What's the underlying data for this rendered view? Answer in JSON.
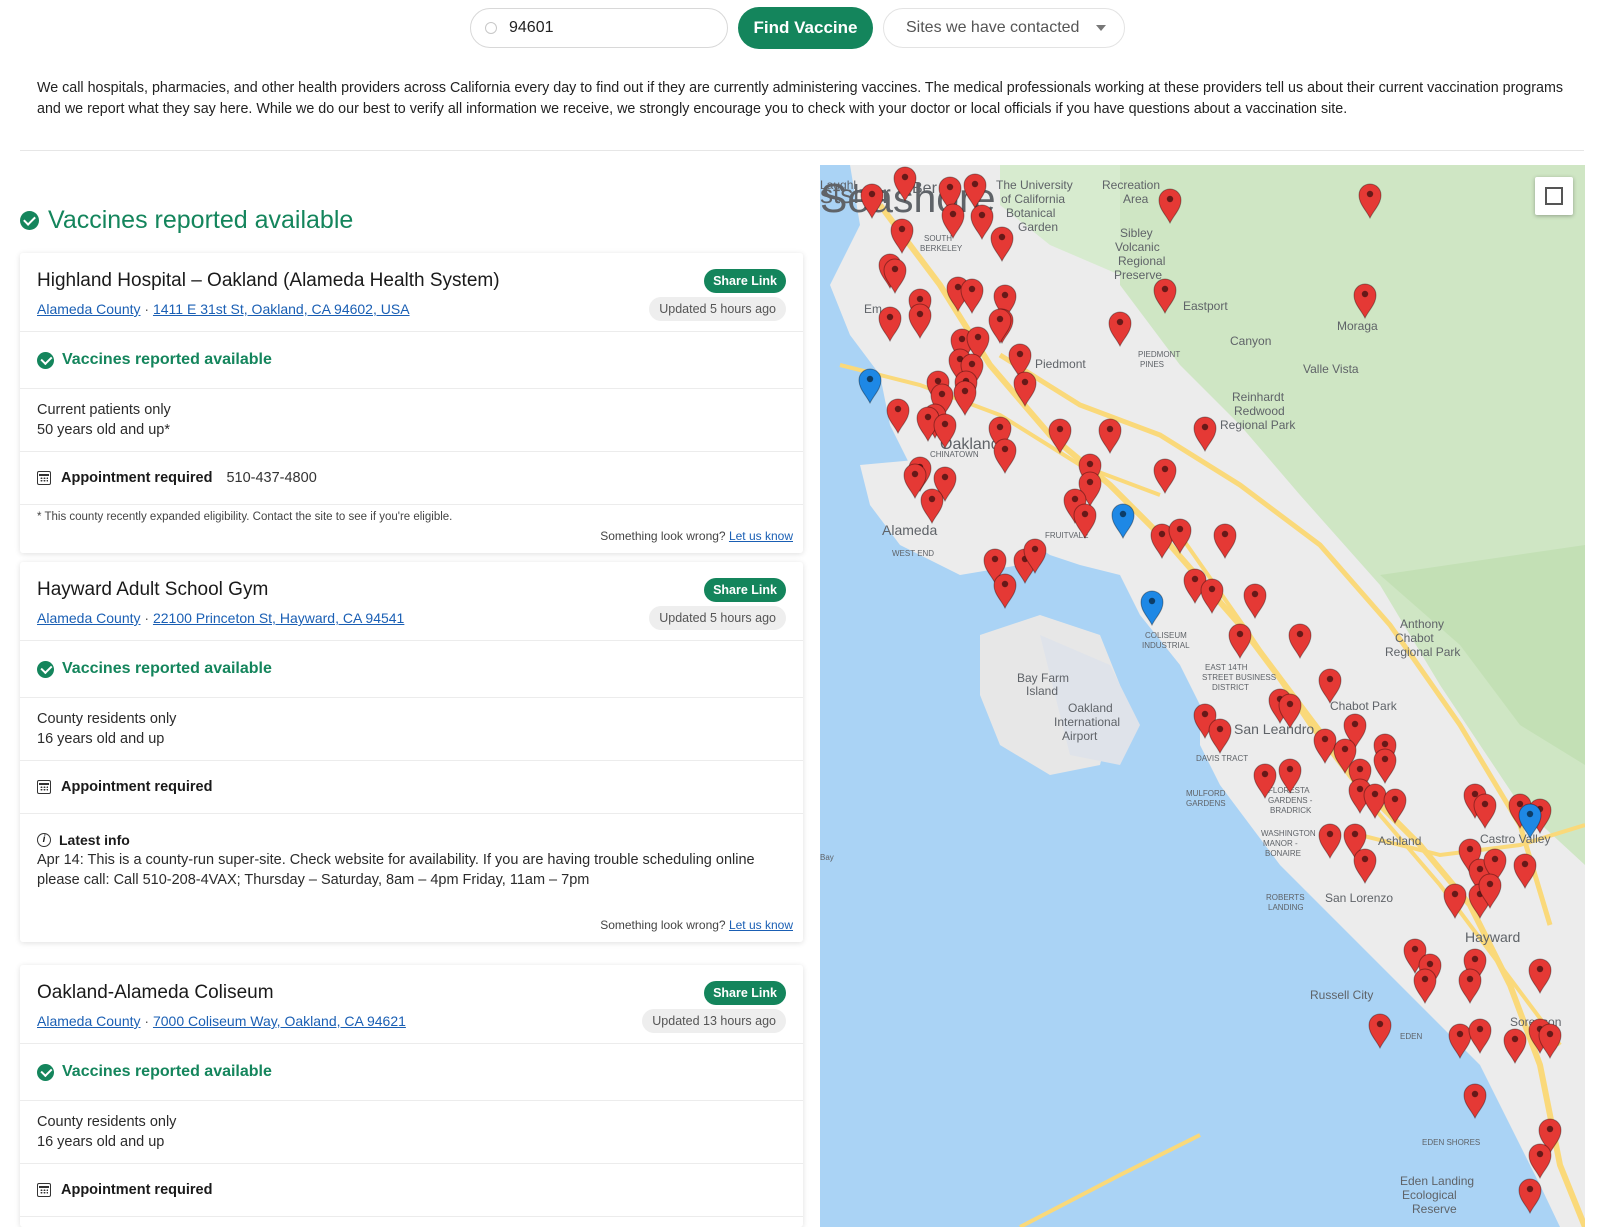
{
  "search": {
    "zip_value": "94601",
    "find_label": "Find Vaccine",
    "filter_label": "Sites we have contacted"
  },
  "intro": "We call hospitals, pharmacies, and other health providers across California every day to find out if they are currently administering vaccines. The medical professionals working at these providers tell us about their current vaccination programs and we report what they say here. While we do our best to verify all information we receive, we strongly encourage you to check with your doctor or local officials if you have questions about a vaccination site.",
  "section_title": "Vaccines reported available",
  "cards": [
    {
      "name": "Highland Hospital – Oakland (Alameda Health System)",
      "county": "Alameda County",
      "address": "1411 E 31st St, Oakland, CA 94602, USA",
      "share": "Share Link",
      "updated": "Updated 5 hours ago",
      "status": "Vaccines reported available",
      "elig1": "Current patients only",
      "elig2": "50 years old and up*",
      "appt": "Appointment required",
      "phone": "510-437-4800",
      "footnote": "* This county recently expanded eligibility. Contact the site to see if you're eligible.",
      "wrong": "Something look wrong?",
      "let_us_know": "Let us know"
    },
    {
      "name": "Hayward Adult School Gym",
      "county": "Alameda County",
      "address": "22100 Princeton St, Hayward, CA 94541",
      "share": "Share Link",
      "updated": "Updated 5 hours ago",
      "status": "Vaccines reported available",
      "elig1": "County residents only",
      "elig2": "16 years old and up",
      "appt": "Appointment required",
      "info_title": "Latest info",
      "info_text": "Apr 14: This is a county-run super-site. Check website for availability. If you are having trouble scheduling online please call: Call 510-208-4VAX; Thursday – Saturday, 8am – 4pm Friday, 11am – 7pm",
      "wrong": "Something look wrong?",
      "let_us_know": "Let us know"
    },
    {
      "name": "Oakland-Alameda Coliseum",
      "county": "Alameda County",
      "address": "7000 Coliseum Way, Oakland, CA 94621",
      "share": "Share Link",
      "updated": "Updated 13 hours ago",
      "status": "Vaccines reported available",
      "elig1": "County residents only",
      "elig2": "16 years old and up",
      "appt": "Appointment required"
    }
  ],
  "map": {
    "labels": [
      "Laughl",
      "stshor",
      "Seashore",
      "Ber",
      "The University",
      "of California",
      "Botanical",
      "Garden",
      "Recreation",
      "Area",
      "SOUTH",
      "BERKELEY",
      "Sibley",
      "Volcanic",
      "Regional",
      "Preserve",
      "Eastport",
      "Moraga",
      "Em",
      "Canyon",
      "Piedmont",
      "PIEDMONT",
      "PINES",
      "Valle Vista",
      "Reinhardt",
      "Redwood",
      "Regional Park",
      "Oakland",
      "CHINATOWN",
      "Alameda",
      "WEST END",
      "FRUITVALE",
      "Anthony",
      "Chabot",
      "Regional Park",
      "Bay Farm",
      "Island",
      "COLISEUM",
      "INDUSTRIAL",
      "EAST 14TH",
      "STREET BUSINESS",
      "DISTRICT",
      "Oakland",
      "International",
      "Airport",
      "Chabot Park",
      "San Leandro",
      "DAVIS TRACT",
      "MULFORD",
      "GARDENS",
      "FLORESTA",
      "GARDENS -",
      "BRADRICK",
      "WASHINGTON",
      "MANOR -",
      "BONAIRE",
      "Ashland",
      "Castro Valley",
      "San Lorenzo",
      "ROBERTS",
      "LANDING",
      "Hayward",
      "Russell City",
      "Sorenson",
      "EDEN",
      "EDEN SHORES",
      "Eden Landing",
      "Ecological",
      "Reserve",
      "Bay"
    ],
    "pin_colors": {
      "red": "#e53935",
      "blue": "#1e88e5"
    }
  }
}
